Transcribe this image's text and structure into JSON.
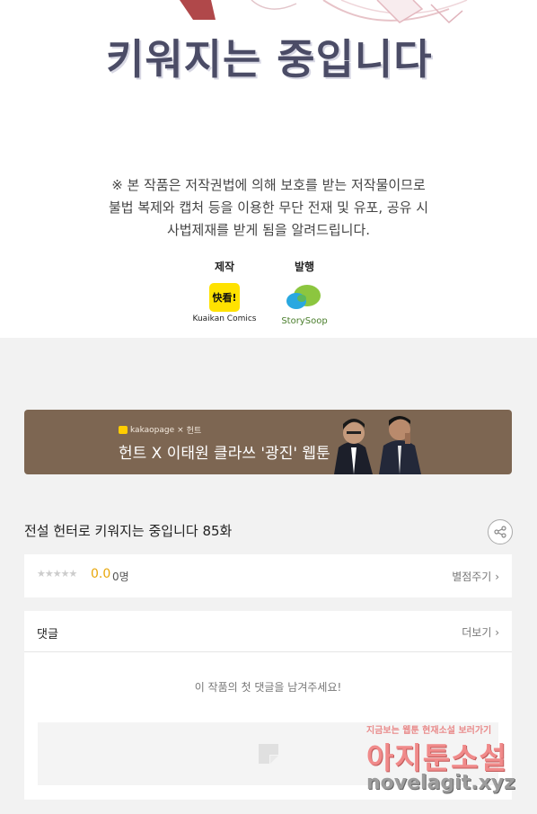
{
  "content_end": {
    "title_art_text": "키워지는 중입니다",
    "copyright_lines": [
      "※ 본 작품은 저작권법에 의해 보호를 받는 저작물이므로",
      "불법 복제와 캡처 등을 이용한 무단 전재 및 유포, 공유 시",
      "사법제재를 받게 됨을 알려드립니다."
    ],
    "production_label": "제작",
    "production_logo_text": "快看!",
    "production_name": "Kuaikan Comics",
    "publisher_label": "발행",
    "publisher_name": "StorySoop"
  },
  "banner": {
    "brand": "kakaopage",
    "partner": "헌트",
    "text": "헌트 X 이태원 클라쓰 '광진' 웹툰"
  },
  "episode": {
    "title": "전설 헌터로 키워지는 중입니다 85화",
    "share_icon": "share-icon"
  },
  "rating": {
    "stars": "★★★★★",
    "score": "0.0",
    "count": "0명",
    "rate_label": "별점주기",
    "star_color": "#cccccc",
    "score_color": "#e8a70b"
  },
  "comments": {
    "title": "댓글",
    "more_label": "더보기",
    "empty_message": "이 작품의 첫 댓글을 남겨주세요!"
  },
  "watermark": {
    "top_line": "지금보는 웹툰 현재소설 보러가기",
    "name": "아지툰소설",
    "url": "novelagit.xyz"
  }
}
